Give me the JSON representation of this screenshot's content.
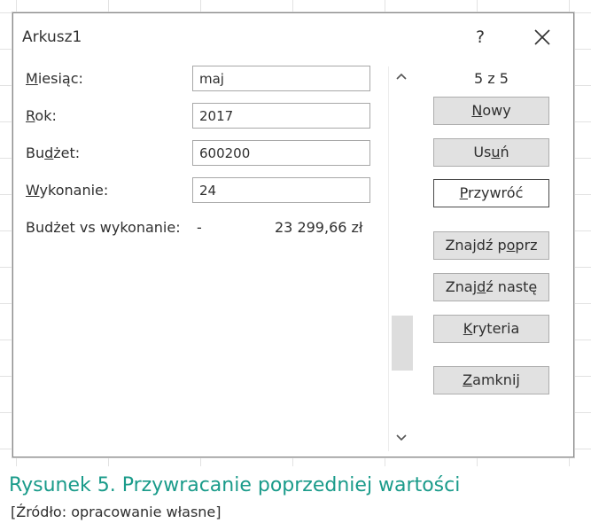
{
  "dialog": {
    "title": "Arkusz1",
    "help_label": "?",
    "record_counter": "5 z 5"
  },
  "fields": [
    {
      "label_u": "M",
      "label_rest": "iesiąc:",
      "value": "maj"
    },
    {
      "label_u": "R",
      "label_rest": "ok:",
      "value": "2017"
    },
    {
      "label_pre": "Bu",
      "label_u": "d",
      "label_rest": "żet:",
      "value": "600200"
    },
    {
      "label_u": "W",
      "label_rest": "ykonanie:",
      "value": "24"
    }
  ],
  "calc": {
    "label_pre": "Bu",
    "label_u": "d",
    "label_rest": "żet vs wykonanie:",
    "dash": "-",
    "value": "23 299,66 zł"
  },
  "buttons": {
    "new": {
      "u": "N",
      "rest": "owy"
    },
    "delete": {
      "pre": "Us",
      "u": "u",
      "rest": "ń"
    },
    "restore": {
      "u": "P",
      "rest": "rzywróć"
    },
    "find_prev": {
      "pre": "Znajdź p",
      "u": "o",
      "rest": "prz"
    },
    "find_next": {
      "pre": "Znaj",
      "u": "d",
      "rest": "ź nastę"
    },
    "criteria": {
      "u": "K",
      "rest": "ryteria"
    },
    "close": {
      "u": "Z",
      "rest": "amknij"
    }
  },
  "caption": "Rysunek 5. Przywracanie poprzedniej wartości",
  "source": "[Źródło: opracowanie własne]",
  "colors": {
    "caption": "#1a9b8a",
    "button_bg": "#e1e1e1",
    "focus_border": "#4a4a4a"
  }
}
